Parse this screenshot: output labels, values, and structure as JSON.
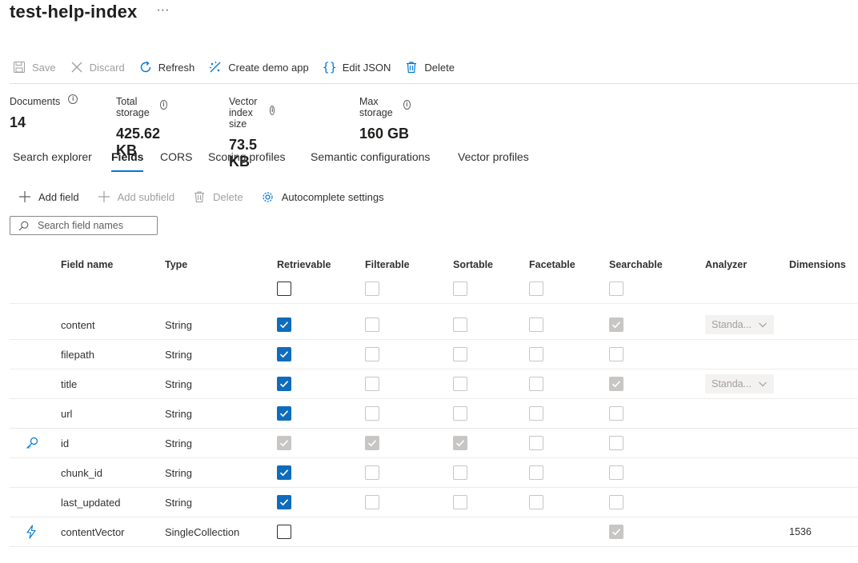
{
  "page": {
    "title": "test-help-index",
    "more": "···"
  },
  "toolbar": {
    "save": "Save",
    "discard": "Discard",
    "refresh": "Refresh",
    "create_demo_app": "Create demo app",
    "edit_json": "Edit JSON",
    "delete": "Delete"
  },
  "stats": [
    {
      "label": "Documents",
      "value": "14"
    },
    {
      "label": "Total storage",
      "value": "425.62 KB"
    },
    {
      "label": "Vector index size",
      "value": "73.5 KB"
    },
    {
      "label": "Max storage",
      "value": "160 GB"
    }
  ],
  "tabs": [
    {
      "label": "Search explorer",
      "active": false
    },
    {
      "label": "Fields",
      "active": true
    },
    {
      "label": "CORS",
      "active": false
    },
    {
      "label": "Scoring profiles",
      "active": false
    },
    {
      "label": "Semantic configurations",
      "active": false
    },
    {
      "label": "Vector profiles",
      "active": false
    }
  ],
  "commands": {
    "add_field": "Add field",
    "add_subfield": "Add subfield",
    "delete": "Delete",
    "autocomplete": "Autocomplete settings"
  },
  "search": {
    "placeholder": "Search field names"
  },
  "columns": {
    "field_name": "Field name",
    "type": "Type",
    "retrievable": "Retrievable",
    "filterable": "Filterable",
    "sortable": "Sortable",
    "facetable": "Facetable",
    "searchable": "Searchable",
    "analyzer": "Analyzer",
    "dimensions": "Dimensions"
  },
  "header_checkboxes": {
    "retrievable": "off",
    "filterable": "dis",
    "sortable": "dis",
    "facetable": "dis",
    "searchable": "dis"
  },
  "fields": [
    {
      "name": "content",
      "type": "String",
      "icon": "",
      "retrievable": "on",
      "filterable": "dis",
      "sortable": "dis",
      "facetable": "dis",
      "searchable": "ondis",
      "analyzer": "Standa...",
      "dimensions": ""
    },
    {
      "name": "filepath",
      "type": "String",
      "icon": "",
      "retrievable": "on",
      "filterable": "dis",
      "sortable": "dis",
      "facetable": "dis",
      "searchable": "dis",
      "analyzer": "",
      "dimensions": ""
    },
    {
      "name": "title",
      "type": "String",
      "icon": "",
      "retrievable": "on",
      "filterable": "dis",
      "sortable": "dis",
      "facetable": "dis",
      "searchable": "ondis",
      "analyzer": "Standa...",
      "dimensions": ""
    },
    {
      "name": "url",
      "type": "String",
      "icon": "",
      "retrievable": "on",
      "filterable": "dis",
      "sortable": "dis",
      "facetable": "dis",
      "searchable": "dis",
      "analyzer": "",
      "dimensions": ""
    },
    {
      "name": "id",
      "type": "String",
      "icon": "key-icon",
      "retrievable": "ondis",
      "filterable": "ondis",
      "sortable": "ondis",
      "facetable": "dis",
      "searchable": "dis",
      "analyzer": "",
      "dimensions": ""
    },
    {
      "name": "chunk_id",
      "type": "String",
      "icon": "",
      "retrievable": "on",
      "filterable": "dis",
      "sortable": "dis",
      "facetable": "dis",
      "searchable": "dis",
      "analyzer": "",
      "dimensions": ""
    },
    {
      "name": "last_updated",
      "type": "String",
      "icon": "",
      "retrievable": "on",
      "filterable": "dis",
      "sortable": "dis",
      "facetable": "dis",
      "searchable": "dis",
      "analyzer": "",
      "dimensions": ""
    },
    {
      "name": "contentVector",
      "type": "SingleCollection",
      "icon": "lightning-icon",
      "retrievable": "off",
      "filterable": "",
      "sortable": "",
      "facetable": "",
      "searchable": "ondis",
      "analyzer": "",
      "dimensions": "1536"
    }
  ],
  "colors": {
    "accent": "#0078d4",
    "checkbox_on": "#0f6cbd",
    "disabled": "#c8c6c4"
  }
}
